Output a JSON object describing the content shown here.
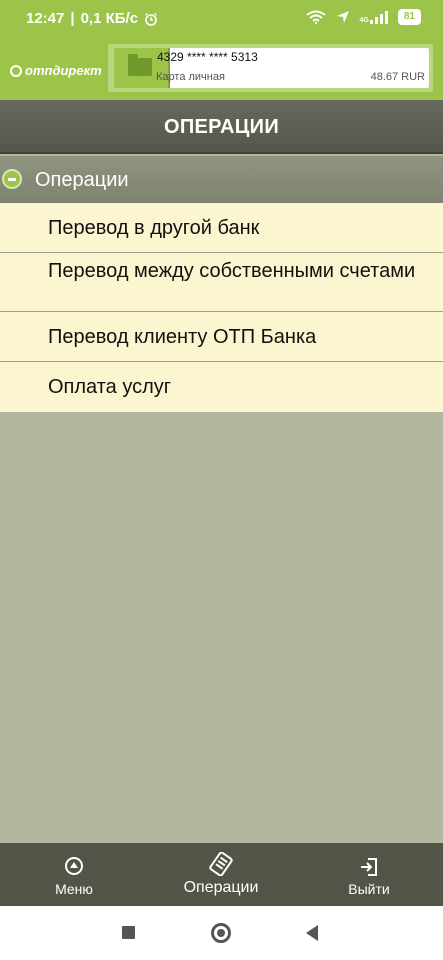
{
  "status_bar": {
    "time": "12:47",
    "speed": "0,1 КБ/с",
    "network": "4G",
    "battery": "81"
  },
  "header": {
    "logo_text": "отпдирект",
    "card": {
      "number": "4329 **** **** 5313",
      "type": "Карта личная",
      "balance": "48.67 RUR"
    }
  },
  "title": "ОПЕРАЦИИ",
  "section": {
    "label": "Операции"
  },
  "operations": [
    {
      "label": "Перевод в другой банк"
    },
    {
      "label": "Перевод между собственными счетами"
    },
    {
      "label": "Перевод клиенту ОТП Банка"
    },
    {
      "label": "Оплата услуг"
    }
  ],
  "bottom_nav": {
    "menu": "Меню",
    "operations": "Операции",
    "exit": "Выйти"
  },
  "colors": {
    "brand_green": "#9bc448",
    "list_bg": "#fbf6cf",
    "title_bar": "#53574c",
    "page_bg": "#b3b69f"
  }
}
